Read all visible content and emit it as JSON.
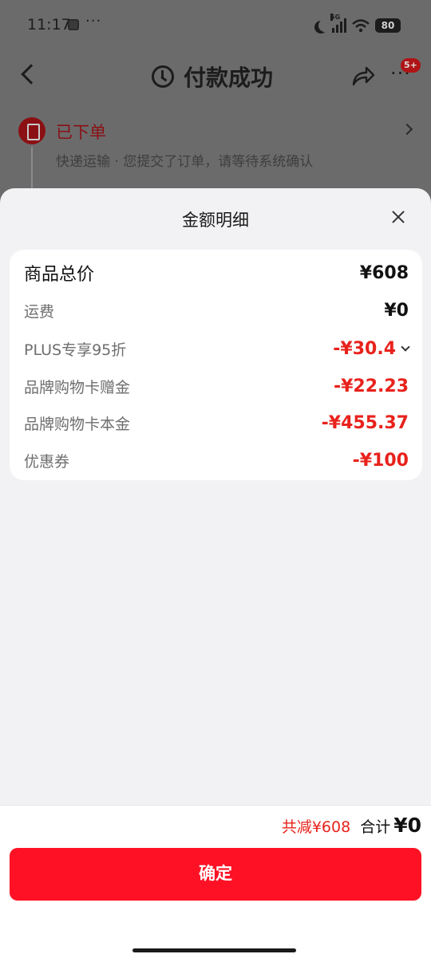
{
  "status_bar": {
    "time": "11:17",
    "dots": "···",
    "network": "5G",
    "battery": "80"
  },
  "nav": {
    "title": "付款成功",
    "badge": "5+"
  },
  "order_status": {
    "title": "已下单",
    "description": "快递运输 · 您提交了订单，请等待系统确认"
  },
  "sheet": {
    "title": "金额明细",
    "rows": [
      {
        "label": "商品总价",
        "value": "¥608"
      },
      {
        "label": "运费",
        "value": "¥0"
      },
      {
        "label": "PLUS专享95折",
        "value": "-¥30.4"
      },
      {
        "label": "品牌购物卡赠金",
        "value": "-¥22.23"
      },
      {
        "label": "品牌购物卡本金",
        "value": "-¥455.37"
      },
      {
        "label": "优惠券",
        "value": "-¥100"
      }
    ]
  },
  "footer": {
    "reduced": "共减¥608",
    "total_label": "合计",
    "total_value": "¥0",
    "confirm_label": "确定"
  },
  "colors": {
    "accent_red": "#e8221c",
    "button_red": "#ff1125",
    "overlay": "#6b6b6b"
  }
}
